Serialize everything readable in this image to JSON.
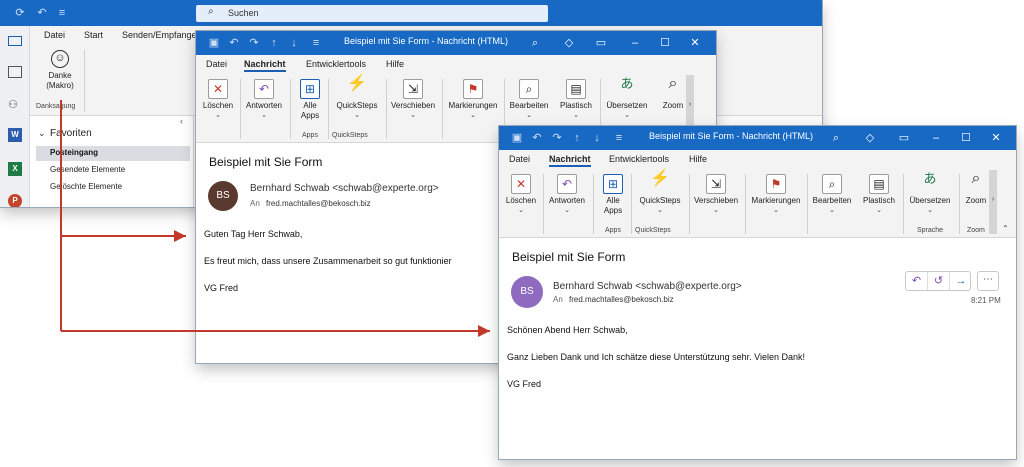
{
  "back_window": {
    "search_placeholder": "Suchen",
    "tabs": [
      "Datei",
      "Start",
      "Senden/Empfange"
    ],
    "thanks_button": "Danke\n(Makro)",
    "thanks_line1": "Danke",
    "thanks_line2": "(Makro)",
    "group_label": "Danksagung",
    "favorites_label": "Favoriten",
    "folders": [
      "Posteingang",
      "Gesendete Elemente",
      "Gelöschte Elemente"
    ]
  },
  "mid_window": {
    "title": "Beispiel mit Sie Form  -  Nachricht (HTML)",
    "tabs": [
      "Datei",
      "Nachricht",
      "Entwicklertools",
      "Hilfe"
    ],
    "ribbon": {
      "delete": "Löschen",
      "respond": "Antworten",
      "all_apps_1": "Alle",
      "all_apps_2": "Apps",
      "quicksteps": "QuickSteps",
      "move": "Verschieben",
      "tags": "Markierungen",
      "edit": "Bearbeiten",
      "immersive": "Plastisch",
      "translate": "Übersetzen",
      "zoom": "Zoom",
      "group_apps": "Apps",
      "group_quicksteps": "QuickSteps"
    },
    "subject": "Beispiel mit Sie Form",
    "avatar": "BS",
    "sender": "Bernhard Schwab <schwab@experte.org>",
    "to_label": "An",
    "to_address": "fred.machtalles@bekosch.biz",
    "body": [
      "Guten Tag Herr Schwab,",
      "Es freut mich, dass unsere Zusammenarbeit so gut funktionier",
      "VG Fred"
    ]
  },
  "front_window": {
    "title": "Beispiel mit Sie Form  -  Nachricht (HTML)",
    "tabs": [
      "Datei",
      "Nachricht",
      "Entwicklertools",
      "Hilfe"
    ],
    "ribbon": {
      "delete": "Löschen",
      "respond": "Antworten",
      "all_apps_1": "Alle",
      "all_apps_2": "Apps",
      "quicksteps": "QuickSteps",
      "move": "Verschieben",
      "tags": "Markierungen",
      "edit": "Bearbeiten",
      "immersive": "Plastisch",
      "translate": "Übersetzen",
      "zoom": "Zoom",
      "group_apps": "Apps",
      "group_quicksteps": "QuickSteps",
      "group_language": "Sprache",
      "group_zoom": "Zoom"
    },
    "subject": "Beispiel mit Sie Form",
    "avatar": "BS",
    "sender": "Bernhard Schwab <schwab@experte.org>",
    "to_label": "An",
    "to_address": "fred.machtalles@bekosch.biz",
    "time": "8:21 PM",
    "body": [
      "Schönen Abend Herr Schwab,",
      "Ganz Lieben Dank und Ich schätze diese Unterstützung sehr. Vielen Dank!",
      "VG Fred"
    ]
  },
  "colors": {
    "titlebar": "#1769c4",
    "arrow": "#c0392b",
    "avatar_mid": "#5a3a2e",
    "avatar_front": "#8e6bbf"
  }
}
